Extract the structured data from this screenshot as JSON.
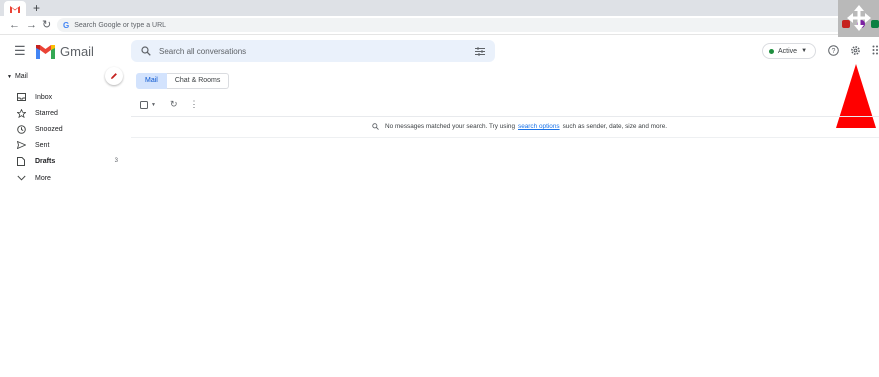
{
  "browser": {
    "tab_plus": "+",
    "omnibox_placeholder": "Search Google or type a URL",
    "omnibox_g": "G"
  },
  "header": {
    "logo_text": "Gmail",
    "search_placeholder": "Search all conversations",
    "status_label": "Active",
    "status_color": "#1e8e3e"
  },
  "sidebar": {
    "section_label": "Mail",
    "items": [
      {
        "label": "Inbox",
        "icon": "inbox-icon",
        "count": ""
      },
      {
        "label": "Starred",
        "icon": "star-icon",
        "count": ""
      },
      {
        "label": "Snoozed",
        "icon": "clock-icon",
        "count": ""
      },
      {
        "label": "Sent",
        "icon": "send-icon",
        "count": ""
      },
      {
        "label": "Drafts",
        "icon": "draft-icon",
        "count": "3"
      },
      {
        "label": "More",
        "icon": "chevron-down-icon",
        "count": ""
      }
    ]
  },
  "main": {
    "tabs": [
      {
        "label": "Mail"
      },
      {
        "label": "Chat & Rooms"
      }
    ],
    "empty_message": {
      "before": "No messages matched your search. Try using",
      "link": "search options",
      "after": "such as sender, date, size and more."
    }
  },
  "colors": {
    "accent": "#0b57d0",
    "annotation_arrow": "#ff0000"
  }
}
